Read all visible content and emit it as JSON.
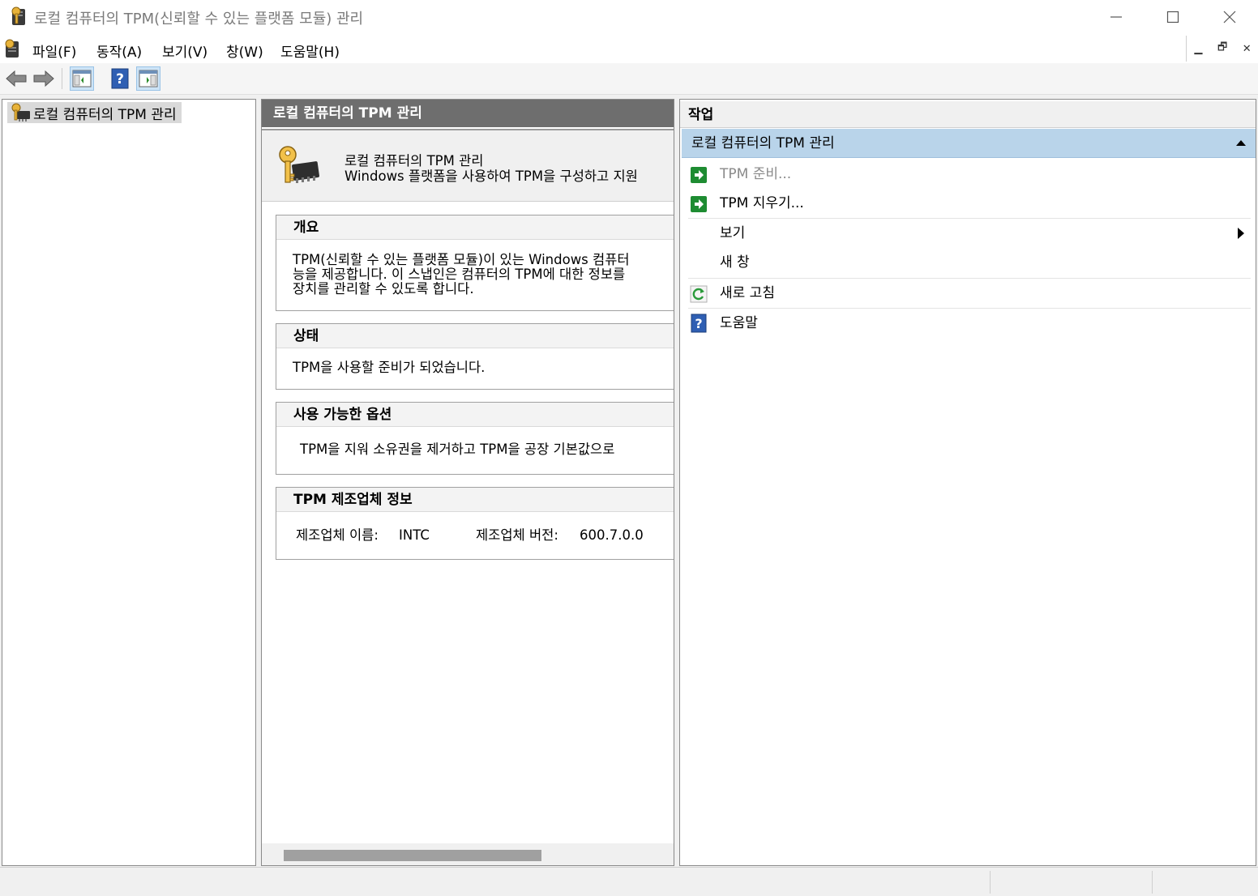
{
  "window": {
    "title": "로컬 컴퓨터의 TPM(신뢰할 수 있는 플랫폼 모듈) 관리"
  },
  "menu": {
    "file": "파일(F)",
    "action": "동작(A)",
    "view": "보기(V)",
    "window": "창(W)",
    "help": "도움말(H)"
  },
  "tree": {
    "root_label": "로컬 컴퓨터의 TPM 관리"
  },
  "center": {
    "header": "로컬 컴퓨터의 TPM 관리",
    "intro_title": "로컬 컴퓨터의 TPM 관리",
    "intro_desc": "Windows 플랫폼을 사용하여 TPM을 구성하고 지원",
    "overview": {
      "title": "개요",
      "lines": [
        "TPM(신뢰할 수 있는 플랫폼 모듈)이 있는 Windows 컴퓨터",
        "능을 제공합니다. 이 스냅인은 컴퓨터의 TPM에 대한 정보를",
        "장치를 관리할 수 있도록 합니다."
      ]
    },
    "status": {
      "title": "상태",
      "text": "TPM을 사용할 준비가 되었습니다."
    },
    "options": {
      "title": "사용 가능한 옵션",
      "text": "TPM을 지워 소유권을 제거하고 TPM을 공장 기본값으로"
    },
    "manufacturer": {
      "title": "TPM 제조업체 정보",
      "name_label": "제조업체 이름:",
      "name_value": "INTC",
      "version_label": "제조업체 버전:",
      "version_value": "600.7.0.0"
    }
  },
  "actions": {
    "header": "작업",
    "group_title": "로컬 컴퓨터의 TPM 관리",
    "items": [
      {
        "label": "TPM 준비...",
        "icon": "green-arrow-icon",
        "enabled": false
      },
      {
        "label": "TPM 지우기...",
        "icon": "green-arrow-icon",
        "enabled": true
      },
      {
        "label": "보기",
        "icon": "",
        "enabled": true
      },
      {
        "label": "새 창",
        "icon": "",
        "enabled": true
      },
      {
        "label": "새로 고침",
        "icon": "refresh-icon",
        "enabled": true
      },
      {
        "label": "도움말",
        "icon": "help-icon",
        "enabled": true
      }
    ]
  },
  "colors": {
    "accent_group": "#b9d4ea",
    "center_header": "#6e6e6e",
    "action_icon_green": "#1e8c32",
    "help_icon_blue": "#2f5fb3"
  }
}
